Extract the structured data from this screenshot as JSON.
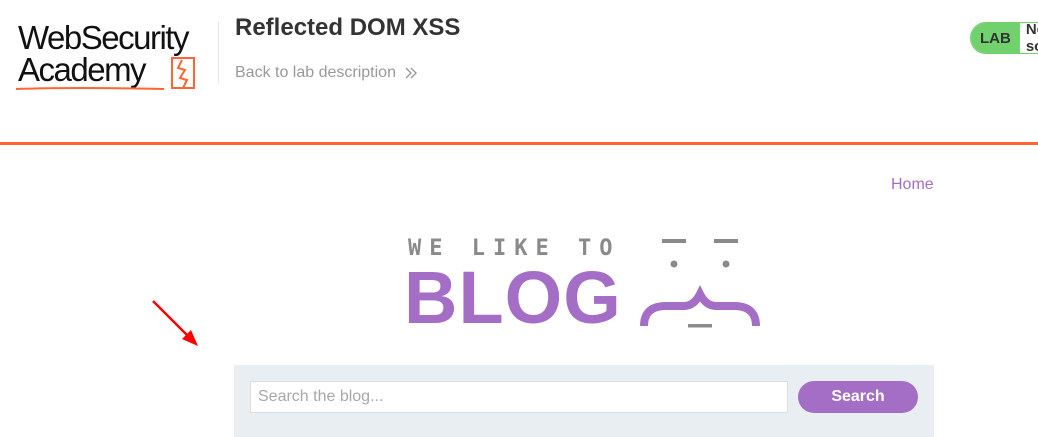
{
  "logo": {
    "line1": "WebSecurity",
    "line2": "Academy"
  },
  "lab": {
    "title": "Reflected DOM XSS",
    "back_link": "Back to lab description",
    "status_badge": "LAB",
    "status_text": "Not solved"
  },
  "nav": {
    "home": "Home"
  },
  "blog": {
    "tagline": "WE LIKE TO",
    "word": "BLOG"
  },
  "search": {
    "placeholder": "Search the blog...",
    "value": "",
    "button_label": "Search"
  },
  "colors": {
    "accent": "#a56ec6",
    "header_rule": "#ff6633",
    "status_green": "#70d16d",
    "annotation": "#ff0000"
  },
  "icons": {
    "back": "double-chevron-right-icon",
    "annotation": "arrow-icon"
  }
}
